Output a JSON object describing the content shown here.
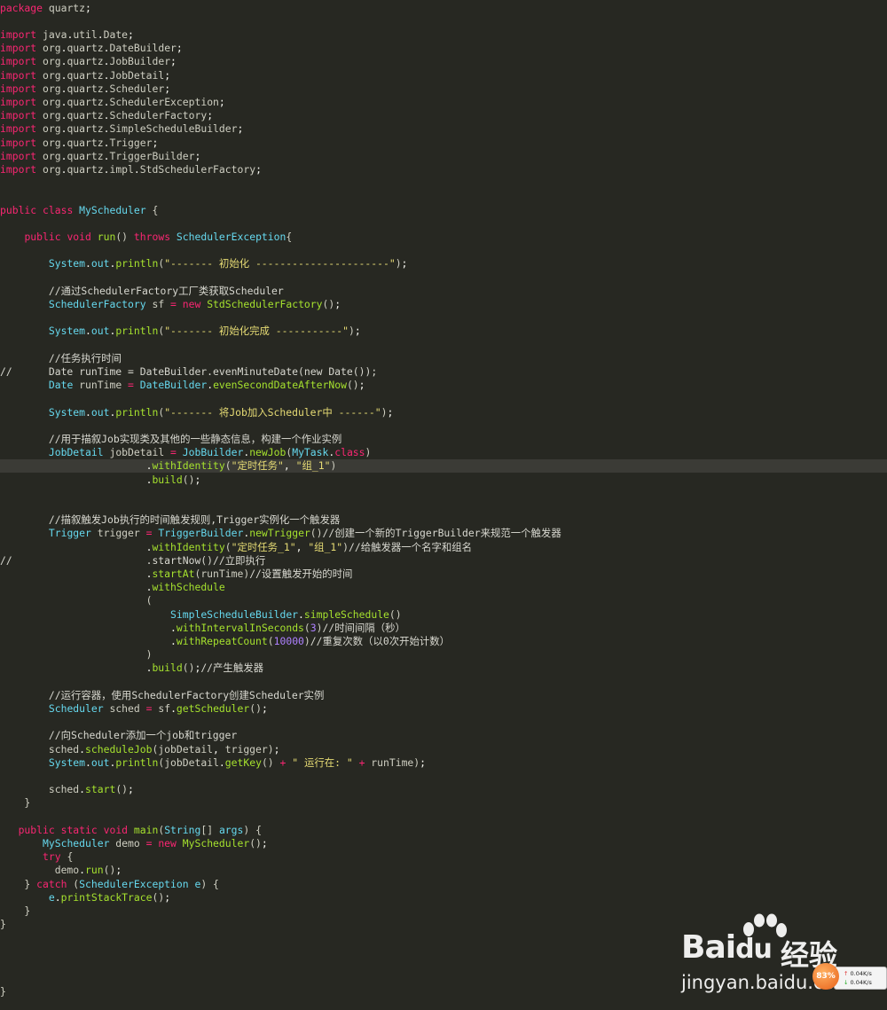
{
  "code_lines": [
    [
      [
        "kw",
        "package"
      ],
      [
        "id",
        " quartz"
      ],
      [
        "pn",
        ";"
      ]
    ],
    [],
    [
      [
        "kw",
        "import"
      ],
      [
        "id",
        " java"
      ],
      [
        "pn",
        "."
      ],
      [
        "id",
        "util"
      ],
      [
        "pn",
        "."
      ],
      [
        "id",
        "Date"
      ],
      [
        "pn",
        ";"
      ]
    ],
    [
      [
        "kw",
        "import"
      ],
      [
        "id",
        " org"
      ],
      [
        "pn",
        "."
      ],
      [
        "id",
        "quartz"
      ],
      [
        "pn",
        "."
      ],
      [
        "id",
        "DateBuilder"
      ],
      [
        "pn",
        ";"
      ]
    ],
    [
      [
        "kw",
        "import"
      ],
      [
        "id",
        " org"
      ],
      [
        "pn",
        "."
      ],
      [
        "id",
        "quartz"
      ],
      [
        "pn",
        "."
      ],
      [
        "id",
        "JobBuilder"
      ],
      [
        "pn",
        ";"
      ]
    ],
    [
      [
        "kw",
        "import"
      ],
      [
        "id",
        " org"
      ],
      [
        "pn",
        "."
      ],
      [
        "id",
        "quartz"
      ],
      [
        "pn",
        "."
      ],
      [
        "id",
        "JobDetail"
      ],
      [
        "pn",
        ";"
      ]
    ],
    [
      [
        "kw",
        "import"
      ],
      [
        "id",
        " org"
      ],
      [
        "pn",
        "."
      ],
      [
        "id",
        "quartz"
      ],
      [
        "pn",
        "."
      ],
      [
        "id",
        "Scheduler"
      ],
      [
        "pn",
        ";"
      ]
    ],
    [
      [
        "kw",
        "import"
      ],
      [
        "id",
        " org"
      ],
      [
        "pn",
        "."
      ],
      [
        "id",
        "quartz"
      ],
      [
        "pn",
        "."
      ],
      [
        "id",
        "SchedulerException"
      ],
      [
        "pn",
        ";"
      ]
    ],
    [
      [
        "kw",
        "import"
      ],
      [
        "id",
        " org"
      ],
      [
        "pn",
        "."
      ],
      [
        "id",
        "quartz"
      ],
      [
        "pn",
        "."
      ],
      [
        "id",
        "SchedulerFactory"
      ],
      [
        "pn",
        ";"
      ]
    ],
    [
      [
        "kw",
        "import"
      ],
      [
        "id",
        " org"
      ],
      [
        "pn",
        "."
      ],
      [
        "id",
        "quartz"
      ],
      [
        "pn",
        "."
      ],
      [
        "id",
        "SimpleScheduleBuilder"
      ],
      [
        "pn",
        ";"
      ]
    ],
    [
      [
        "kw",
        "import"
      ],
      [
        "id",
        " org"
      ],
      [
        "pn",
        "."
      ],
      [
        "id",
        "quartz"
      ],
      [
        "pn",
        "."
      ],
      [
        "id",
        "Trigger"
      ],
      [
        "pn",
        ";"
      ]
    ],
    [
      [
        "kw",
        "import"
      ],
      [
        "id",
        " org"
      ],
      [
        "pn",
        "."
      ],
      [
        "id",
        "quartz"
      ],
      [
        "pn",
        "."
      ],
      [
        "id",
        "TriggerBuilder"
      ],
      [
        "pn",
        ";"
      ]
    ],
    [
      [
        "kw",
        "import"
      ],
      [
        "id",
        " org"
      ],
      [
        "pn",
        "."
      ],
      [
        "id",
        "quartz"
      ],
      [
        "pn",
        "."
      ],
      [
        "id",
        "impl"
      ],
      [
        "pn",
        "."
      ],
      [
        "id",
        "StdSchedulerFactory"
      ],
      [
        "pn",
        ";"
      ]
    ],
    [],
    [],
    [
      [
        "kw",
        "public"
      ],
      [
        "id",
        " "
      ],
      [
        "kw",
        "class"
      ],
      [
        "id",
        " "
      ],
      [
        "ty",
        "MyScheduler"
      ],
      [
        "id",
        " {"
      ]
    ],
    [],
    [
      [
        "id",
        "    "
      ],
      [
        "kw",
        "public"
      ],
      [
        "id",
        " "
      ],
      [
        "kw",
        "void"
      ],
      [
        "id",
        " "
      ],
      [
        "fn",
        "run"
      ],
      [
        "id",
        "() "
      ],
      [
        "kw",
        "throws"
      ],
      [
        "id",
        " "
      ],
      [
        "ty",
        "SchedulerException"
      ],
      [
        "id",
        "{"
      ]
    ],
    [],
    [
      [
        "id",
        "        "
      ],
      [
        "ty",
        "System"
      ],
      [
        "pn",
        "."
      ],
      [
        "ty",
        "out"
      ],
      [
        "pn",
        "."
      ],
      [
        "fn",
        "println"
      ],
      [
        "id",
        "("
      ],
      [
        "st",
        "\"------- 初始化 ----------------------\""
      ],
      [
        "id",
        ")"
      ],
      [
        "pn",
        ";"
      ]
    ],
    [],
    [
      [
        "id",
        "        "
      ],
      [
        "cm",
        "//通过SchedulerFactory工厂类获取Scheduler"
      ]
    ],
    [
      [
        "id",
        "        "
      ],
      [
        "ty",
        "SchedulerFactory"
      ],
      [
        "id",
        " sf "
      ],
      [
        "op",
        "="
      ],
      [
        "id",
        " "
      ],
      [
        "kw",
        "new"
      ],
      [
        "id",
        " "
      ],
      [
        "fn",
        "StdSchedulerFactory"
      ],
      [
        "id",
        "()"
      ],
      [
        "pn",
        ";"
      ]
    ],
    [],
    [
      [
        "id",
        "        "
      ],
      [
        "ty",
        "System"
      ],
      [
        "pn",
        "."
      ],
      [
        "ty",
        "out"
      ],
      [
        "pn",
        "."
      ],
      [
        "fn",
        "println"
      ],
      [
        "id",
        "("
      ],
      [
        "st",
        "\"------- 初始化完成 -----------\""
      ],
      [
        "id",
        ")"
      ],
      [
        "pn",
        ";"
      ]
    ],
    [],
    [
      [
        "id",
        "        "
      ],
      [
        "cm",
        "//任务执行时间"
      ]
    ],
    [
      [
        "cm",
        "//      Date runTime = DateBuilder.evenMinuteDate(new Date());"
      ]
    ],
    [
      [
        "id",
        "        "
      ],
      [
        "ty",
        "Date"
      ],
      [
        "id",
        " runTime "
      ],
      [
        "op",
        "="
      ],
      [
        "id",
        " "
      ],
      [
        "ty",
        "DateBuilder"
      ],
      [
        "pn",
        "."
      ],
      [
        "fn",
        "evenSecondDateAfterNow"
      ],
      [
        "id",
        "()"
      ],
      [
        "pn",
        ";"
      ]
    ],
    [],
    [
      [
        "id",
        "        "
      ],
      [
        "ty",
        "System"
      ],
      [
        "pn",
        "."
      ],
      [
        "ty",
        "out"
      ],
      [
        "pn",
        "."
      ],
      [
        "fn",
        "println"
      ],
      [
        "id",
        "("
      ],
      [
        "st",
        "\"------- 将Job加入Scheduler中 ------\""
      ],
      [
        "id",
        ")"
      ],
      [
        "pn",
        ";"
      ]
    ],
    [],
    [
      [
        "id",
        "        "
      ],
      [
        "cm",
        "//用于描叙Job实现类及其他的一些静态信息，构建一个作业实例"
      ]
    ],
    [
      [
        "id",
        "        "
      ],
      [
        "ty",
        "JobDetail"
      ],
      [
        "id",
        " jobDetail "
      ],
      [
        "op",
        "="
      ],
      [
        "id",
        " "
      ],
      [
        "ty",
        "JobBuilder"
      ],
      [
        "pn",
        "."
      ],
      [
        "fn",
        "newJob"
      ],
      [
        "id",
        "("
      ],
      [
        "ty",
        "MyTask"
      ],
      [
        "pn",
        "."
      ],
      [
        "kw",
        "class"
      ],
      [
        "id",
        ")"
      ]
    ],
    [
      [
        "id",
        "                        "
      ],
      [
        "pn",
        "."
      ],
      [
        "fn",
        "withIdentity"
      ],
      [
        "id",
        "("
      ],
      [
        "st",
        "\"定时任务\""
      ],
      [
        "pn",
        ", "
      ],
      [
        "st",
        "\"组_1\""
      ],
      [
        "id",
        ")"
      ]
    ],
    [
      [
        "id",
        "                        "
      ],
      [
        "pn",
        "."
      ],
      [
        "fn",
        "build"
      ],
      [
        "id",
        "()"
      ],
      [
        "pn",
        ";"
      ]
    ],
    [],
    [],
    [
      [
        "id",
        "        "
      ],
      [
        "cm",
        "//描叙触发Job执行的时间触发规则,Trigger实例化一个触发器"
      ]
    ],
    [
      [
        "id",
        "        "
      ],
      [
        "ty",
        "Trigger"
      ],
      [
        "id",
        " trigger "
      ],
      [
        "op",
        "="
      ],
      [
        "id",
        " "
      ],
      [
        "ty",
        "TriggerBuilder"
      ],
      [
        "pn",
        "."
      ],
      [
        "fn",
        "newTrigger"
      ],
      [
        "id",
        "()"
      ],
      [
        "cm",
        "//创建一个新的TriggerBuilder来规范一个触发器"
      ]
    ],
    [
      [
        "id",
        "                        "
      ],
      [
        "pn",
        "."
      ],
      [
        "fn",
        "withIdentity"
      ],
      [
        "id",
        "("
      ],
      [
        "st",
        "\"定时任务_1\""
      ],
      [
        "pn",
        ", "
      ],
      [
        "st",
        "\"组_1\""
      ],
      [
        "id",
        ")"
      ],
      [
        "cm",
        "//给触发器一个名字和组名"
      ]
    ],
    [
      [
        "cm",
        "//                      .startNow()//立即执行"
      ]
    ],
    [
      [
        "id",
        "                        "
      ],
      [
        "pn",
        "."
      ],
      [
        "fn",
        "startAt"
      ],
      [
        "id",
        "(runTime)"
      ],
      [
        "cm",
        "//设置触发开始的时间"
      ]
    ],
    [
      [
        "id",
        "                        "
      ],
      [
        "pn",
        "."
      ],
      [
        "fn",
        "withSchedule"
      ]
    ],
    [
      [
        "id",
        "                        ("
      ]
    ],
    [
      [
        "id",
        "                            "
      ],
      [
        "ty",
        "SimpleScheduleBuilder"
      ],
      [
        "pn",
        "."
      ],
      [
        "fn",
        "simpleSchedule"
      ],
      [
        "id",
        "()"
      ]
    ],
    [
      [
        "id",
        "                            "
      ],
      [
        "pn",
        "."
      ],
      [
        "fn",
        "withIntervalInSeconds"
      ],
      [
        "id",
        "("
      ],
      [
        "nu",
        "3"
      ],
      [
        "id",
        ")"
      ],
      [
        "cm",
        "//时间间隔（秒）"
      ]
    ],
    [
      [
        "id",
        "                            "
      ],
      [
        "pn",
        "."
      ],
      [
        "fn",
        "withRepeatCount"
      ],
      [
        "id",
        "("
      ],
      [
        "nu",
        "10000"
      ],
      [
        "id",
        ")"
      ],
      [
        "cm",
        "//重复次数（以0次开始计数）"
      ]
    ],
    [
      [
        "id",
        "                        )"
      ]
    ],
    [
      [
        "id",
        "                        "
      ],
      [
        "pn",
        "."
      ],
      [
        "fn",
        "build"
      ],
      [
        "id",
        "()"
      ],
      [
        "pn",
        ";"
      ],
      [
        "cm",
        "//产生触发器"
      ]
    ],
    [],
    [
      [
        "id",
        "        "
      ],
      [
        "cm",
        "//运行容器，使用SchedulerFactory创建Scheduler实例"
      ]
    ],
    [
      [
        "id",
        "        "
      ],
      [
        "ty",
        "Scheduler"
      ],
      [
        "id",
        " sched "
      ],
      [
        "op",
        "="
      ],
      [
        "id",
        " sf"
      ],
      [
        "pn",
        "."
      ],
      [
        "fn",
        "getScheduler"
      ],
      [
        "id",
        "()"
      ],
      [
        "pn",
        ";"
      ]
    ],
    [],
    [
      [
        "id",
        "        "
      ],
      [
        "cm",
        "//向Scheduler添加一个job和trigger"
      ]
    ],
    [
      [
        "id",
        "        sched"
      ],
      [
        "pn",
        "."
      ],
      [
        "fn",
        "scheduleJob"
      ],
      [
        "id",
        "(jobDetail"
      ],
      [
        "pn",
        ","
      ],
      [
        "id",
        " trigger)"
      ],
      [
        "pn",
        ";"
      ]
    ],
    [
      [
        "id",
        "        "
      ],
      [
        "ty",
        "System"
      ],
      [
        "pn",
        "."
      ],
      [
        "ty",
        "out"
      ],
      [
        "pn",
        "."
      ],
      [
        "fn",
        "println"
      ],
      [
        "id",
        "(jobDetail"
      ],
      [
        "pn",
        "."
      ],
      [
        "fn",
        "getKey"
      ],
      [
        "id",
        "() "
      ],
      [
        "op",
        "+"
      ],
      [
        "id",
        " "
      ],
      [
        "st",
        "\" 运行在: \""
      ],
      [
        "id",
        " "
      ],
      [
        "op",
        "+"
      ],
      [
        "id",
        " runTime)"
      ],
      [
        "pn",
        ";"
      ]
    ],
    [],
    [
      [
        "id",
        "        sched"
      ],
      [
        "pn",
        "."
      ],
      [
        "fn",
        "start"
      ],
      [
        "id",
        "()"
      ],
      [
        "pn",
        ";"
      ]
    ],
    [
      [
        "id",
        "    }"
      ]
    ],
    [],
    [
      [
        "id",
        "   "
      ],
      [
        "kw",
        "public"
      ],
      [
        "id",
        " "
      ],
      [
        "kw",
        "static"
      ],
      [
        "id",
        " "
      ],
      [
        "kw",
        "void"
      ],
      [
        "id",
        " "
      ],
      [
        "fn",
        "main"
      ],
      [
        "id",
        "("
      ],
      [
        "ty",
        "String"
      ],
      [
        "id",
        "[] "
      ],
      [
        "ty",
        "args"
      ],
      [
        "id",
        ") {"
      ]
    ],
    [
      [
        "id",
        "       "
      ],
      [
        "ty",
        "MyScheduler"
      ],
      [
        "id",
        " demo "
      ],
      [
        "op",
        "="
      ],
      [
        "id",
        " "
      ],
      [
        "kw",
        "new"
      ],
      [
        "id",
        " "
      ],
      [
        "fn",
        "MyScheduler"
      ],
      [
        "id",
        "()"
      ],
      [
        "pn",
        ";"
      ]
    ],
    [
      [
        "id",
        "       "
      ],
      [
        "kw",
        "try"
      ],
      [
        "id",
        " {"
      ]
    ],
    [
      [
        "id",
        "         demo"
      ],
      [
        "pn",
        "."
      ],
      [
        "fn",
        "run"
      ],
      [
        "id",
        "()"
      ],
      [
        "pn",
        ";"
      ]
    ],
    [
      [
        "id",
        "    } "
      ],
      [
        "kw",
        "catch"
      ],
      [
        "id",
        " ("
      ],
      [
        "ty",
        "SchedulerException"
      ],
      [
        "id",
        " "
      ],
      [
        "ty",
        "e"
      ],
      [
        "id",
        ") {"
      ]
    ],
    [
      [
        "id",
        "        "
      ],
      [
        "ty",
        "e"
      ],
      [
        "pn",
        "."
      ],
      [
        "fn",
        "printStackTrace"
      ],
      [
        "id",
        "()"
      ],
      [
        "pn",
        ";"
      ]
    ],
    [
      [
        "id",
        "    }"
      ]
    ],
    [
      [
        "id",
        "}"
      ]
    ],
    [],
    [],
    [],
    [],
    [
      [
        "id",
        "}"
      ]
    ]
  ],
  "watermark": {
    "brand": "Bai",
    "brand_suffix": "du",
    "jingyan": "经验",
    "url": "jingyan.baidu.com"
  },
  "net_widget": {
    "percent": "83%",
    "up": "0.04K/s",
    "down": "0.04K/s",
    "up_arrow": "↑",
    "down_arrow": "↓",
    "close": "×"
  },
  "colors": {
    "background": "#272822",
    "keyword": "#f92672",
    "type": "#66d9ef",
    "function": "#a6e22e",
    "string": "#e6db74",
    "number": "#ae81ff",
    "current_line": "#3b3b36"
  }
}
